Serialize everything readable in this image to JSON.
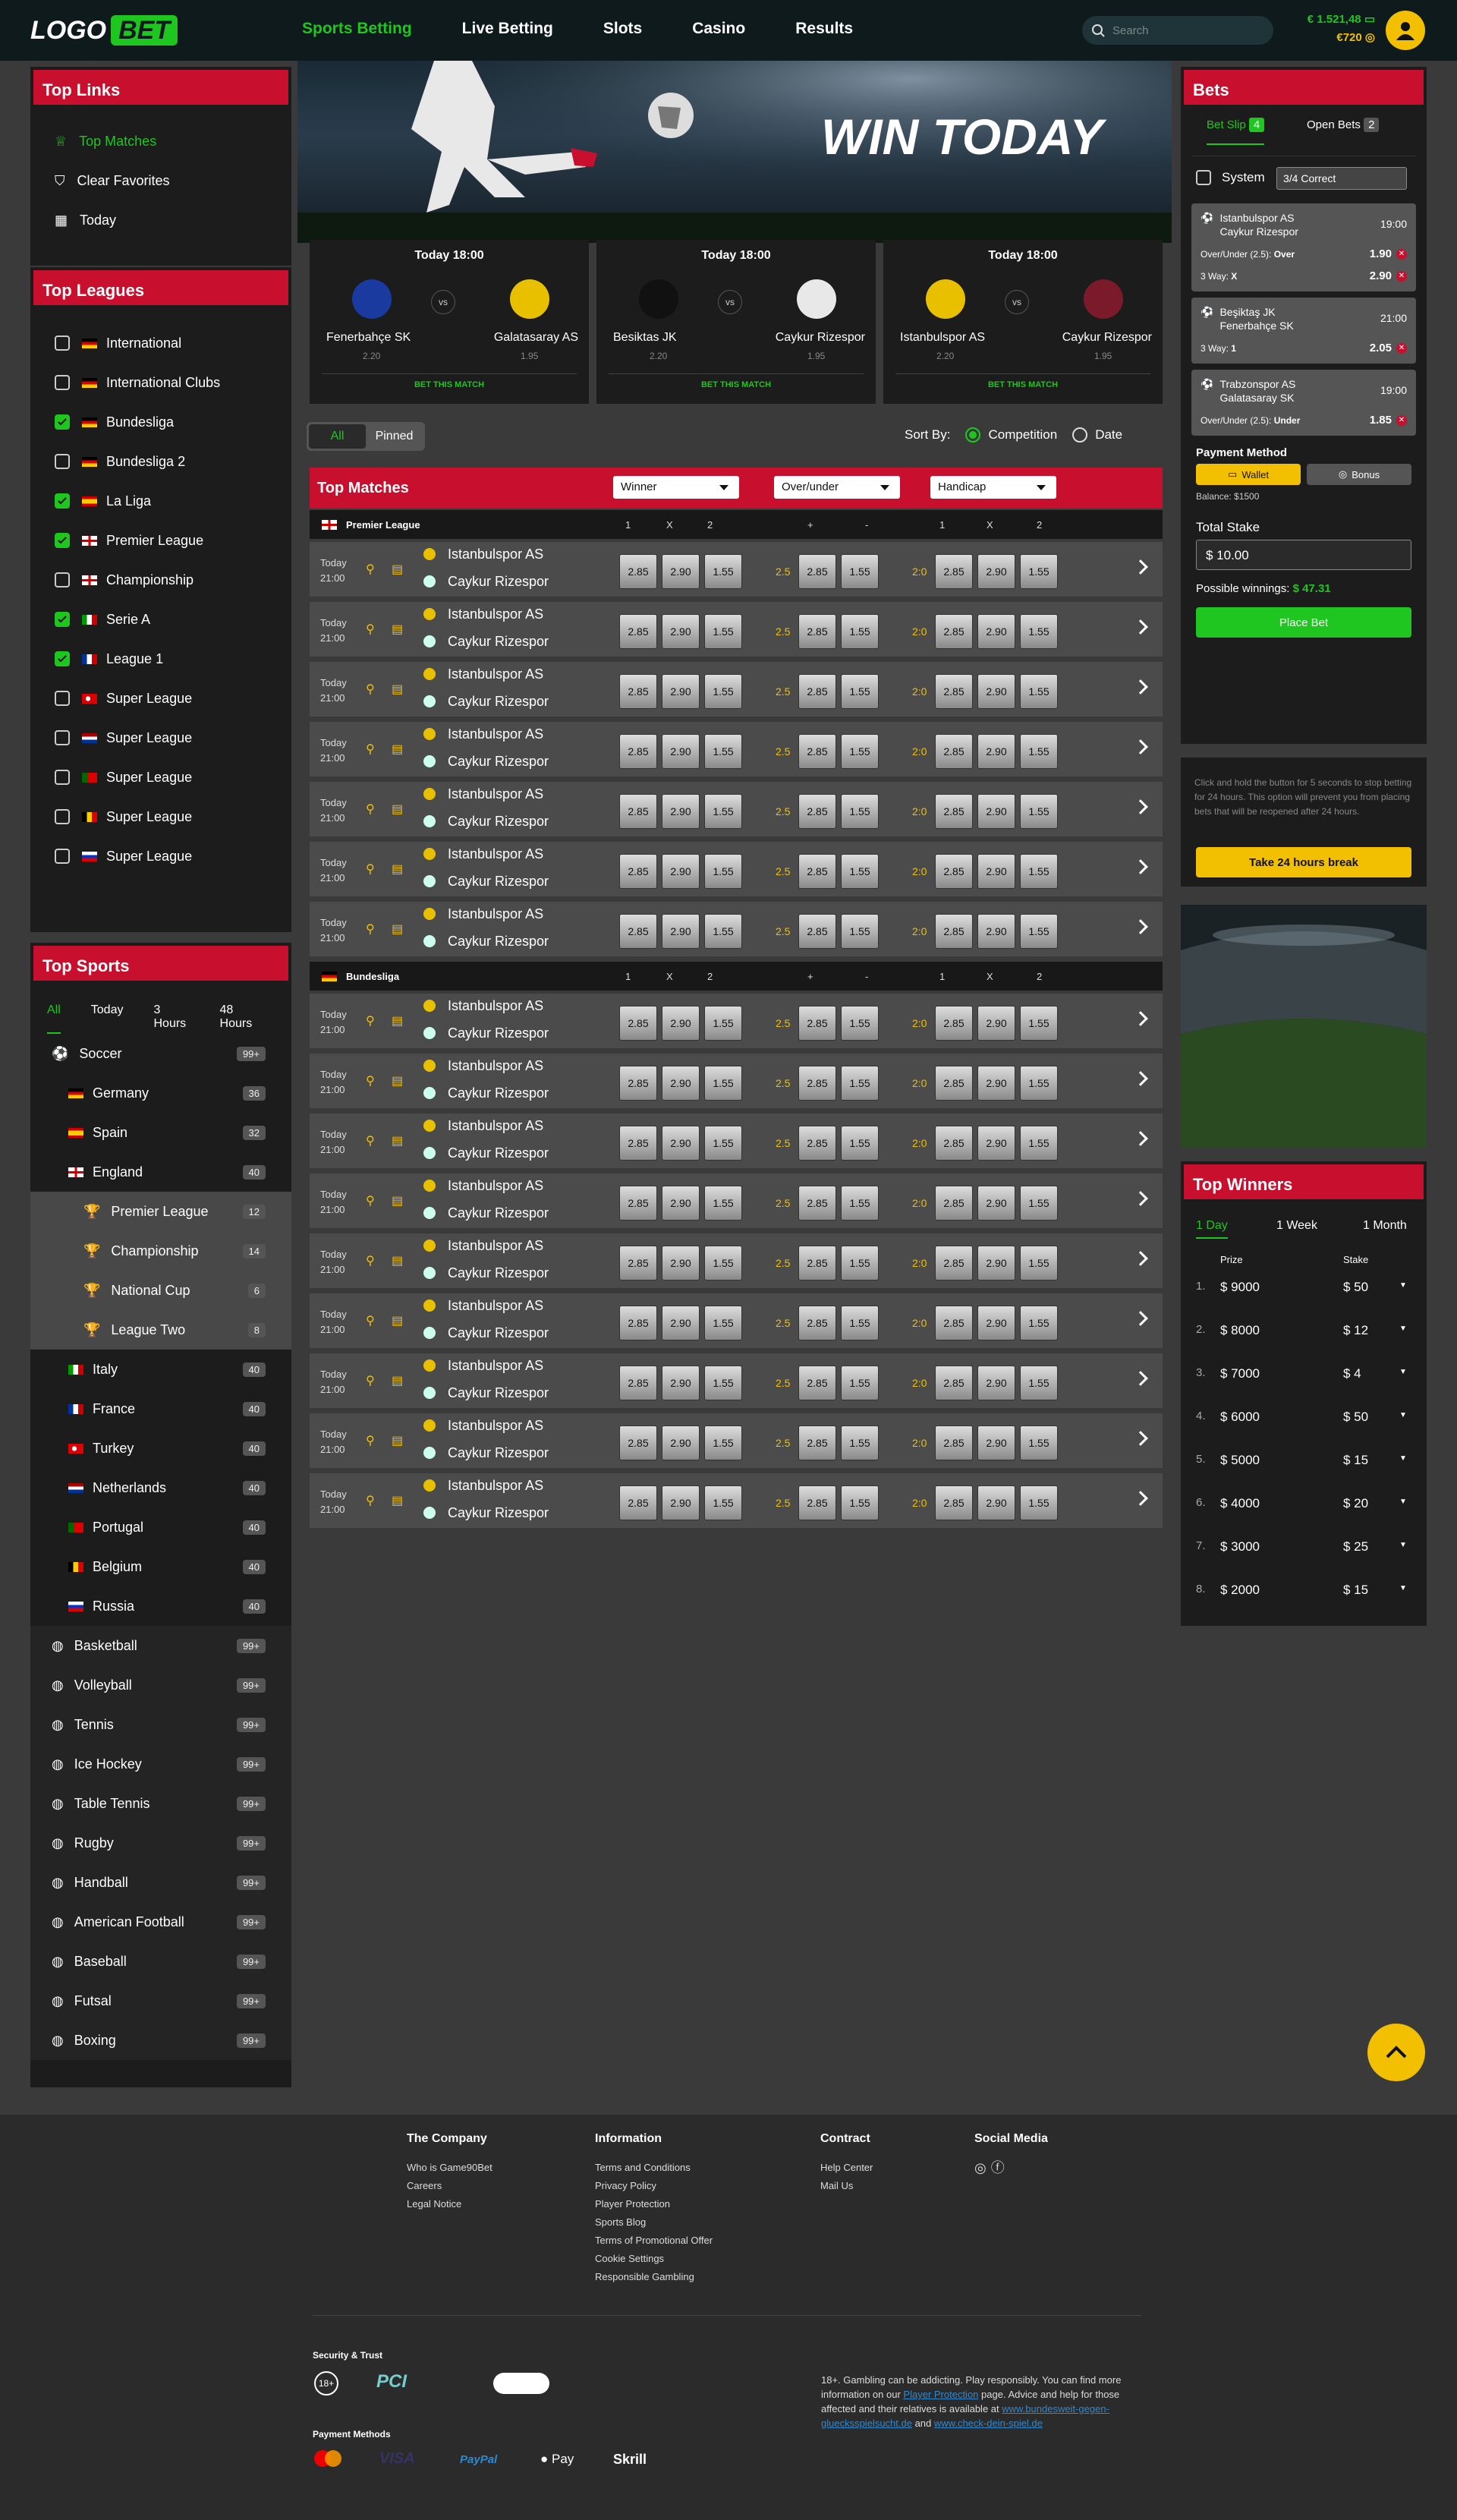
{
  "header": {
    "logo_a": "LOGO",
    "logo_b": "BET",
    "nav": [
      "Sports Betting",
      "Live Betting",
      "Slots",
      "Casino",
      "Results"
    ],
    "search_placeholder": "Search",
    "balance_main": "€ 1.521,48",
    "balance_bonus": "€720"
  },
  "top_links": {
    "title": "Top Links",
    "items": [
      "Top Matches",
      "Clear Favorites",
      "Today"
    ]
  },
  "top_leagues": {
    "title": "Top Leagues",
    "items": [
      {
        "name": "International",
        "checked": false,
        "flag": "de"
      },
      {
        "name": "International Clubs",
        "checked": false,
        "flag": "de"
      },
      {
        "name": "Bundesliga",
        "checked": true,
        "flag": "de"
      },
      {
        "name": "Bundesliga 2",
        "checked": false,
        "flag": "de"
      },
      {
        "name": "La Liga",
        "checked": true,
        "flag": "es"
      },
      {
        "name": "Premier League",
        "checked": true,
        "flag": "en"
      },
      {
        "name": "Championship",
        "checked": false,
        "flag": "en"
      },
      {
        "name": "Serie A",
        "checked": true,
        "flag": "it"
      },
      {
        "name": "League 1",
        "checked": true,
        "flag": "fr"
      },
      {
        "name": "Super League",
        "checked": false,
        "flag": "tr"
      },
      {
        "name": "Super League",
        "checked": false,
        "flag": "nl"
      },
      {
        "name": "Super League",
        "checked": false,
        "flag": "pt"
      },
      {
        "name": "Super League",
        "checked": false,
        "flag": "be"
      },
      {
        "name": "Super League",
        "checked": false,
        "flag": "ru"
      }
    ]
  },
  "top_sports": {
    "title": "Top Sports",
    "tabs": [
      "All",
      "Today",
      "3 Hours",
      "48 Hours"
    ],
    "soccer": {
      "name": "Soccer",
      "count": "99+"
    },
    "countries1": [
      {
        "name": "Germany",
        "count": "36",
        "flag": "de"
      },
      {
        "name": "Spain",
        "count": "32",
        "flag": "es"
      },
      {
        "name": "England",
        "count": "40",
        "flag": "en"
      }
    ],
    "leagues": [
      {
        "name": "Premier League",
        "count": "12"
      },
      {
        "name": "Championship",
        "count": "14"
      },
      {
        "name": "National Cup",
        "count": "6"
      },
      {
        "name": "League Two",
        "count": "8"
      }
    ],
    "countries2": [
      {
        "name": "Italy",
        "count": "40",
        "flag": "it"
      },
      {
        "name": "France",
        "count": "40",
        "flag": "fr"
      },
      {
        "name": "Turkey",
        "count": "40",
        "flag": "tr"
      },
      {
        "name": "Netherlands",
        "count": "40",
        "flag": "nl"
      },
      {
        "name": "Portugal",
        "count": "40",
        "flag": "pt"
      },
      {
        "name": "Belgium",
        "count": "40",
        "flag": "be"
      },
      {
        "name": "Russia",
        "count": "40",
        "flag": "ru"
      }
    ],
    "sports": [
      {
        "name": "Basketball",
        "count": "99+"
      },
      {
        "name": "Volleyball",
        "count": "99+"
      },
      {
        "name": "Tennis",
        "count": "99+"
      },
      {
        "name": "Ice Hockey",
        "count": "99+"
      },
      {
        "name": "Table Tennis",
        "count": "99+"
      },
      {
        "name": "Rugby",
        "count": "99+"
      },
      {
        "name": "Handball",
        "count": "99+"
      },
      {
        "name": "American Football",
        "count": "99+"
      },
      {
        "name": "Baseball",
        "count": "99+"
      },
      {
        "name": "Futsal",
        "count": "99+"
      },
      {
        "name": "Boxing",
        "count": "99+"
      }
    ]
  },
  "hero": {
    "text": "WIN TODAY"
  },
  "featured": [
    {
      "time": "Today 18:00",
      "home": "Fenerbahçe SK",
      "away": "Galatasaray AS",
      "odd_home": "2.20",
      "odd_away": "1.95",
      "cta": "BET THIS MATCH"
    },
    {
      "time": "Today 18:00",
      "home": "Besiktas JK",
      "away": "Caykur Rizespor",
      "odd_home": "2.20",
      "odd_away": "1.95",
      "cta": "BET THIS MATCH"
    },
    {
      "time": "Today 18:00",
      "home": "Istanbulspor AS",
      "away": "Caykur Rizespor",
      "odd_home": "2.20",
      "odd_away": "1.95",
      "cta": "BET THIS MATCH"
    }
  ],
  "filter": {
    "all": "All",
    "pinned": "Pinned",
    "sort_by": "Sort By:",
    "competition": "Competition",
    "date": "Date"
  },
  "top_matches": {
    "title": "Top Matches",
    "dd1": "Winner",
    "dd2": "Over/under",
    "dd3": "Handicap",
    "col_labels": [
      "1",
      "X",
      "2",
      "+",
      "-",
      "1",
      "X",
      "2"
    ],
    "leagues": [
      {
        "name": "Premier League",
        "flag": "en",
        "rows": 7
      },
      {
        "name": "Bundesliga",
        "flag": "de",
        "rows": 9
      }
    ],
    "row": {
      "day": "Today",
      "time": "21:00",
      "home": "Istanbulspor AS",
      "away": "Caykur Rizespor",
      "o1": "2.85",
      "o2": "2.90",
      "o3": "1.55",
      "ou": "2.5",
      "ou1": "2.85",
      "ou2": "1.55",
      "hc": "2:0",
      "h1": "2.85",
      "h2": "2.90",
      "h3": "1.55"
    }
  },
  "bets": {
    "title": "Bets",
    "bet_slip": "Bet Slip",
    "bet_slip_count": "4",
    "open_bets": "Open Bets",
    "open_bets_count": "2",
    "system": "System",
    "system_value": "3/4 Correct",
    "slips": [
      {
        "teams1": "Istanbulspor AS",
        "teams2": "Caykur Rizespor",
        "time": "19:00",
        "lines": [
          {
            "label": "Over/Under (2.5): ",
            "bold": "Over",
            "odd": "1.90"
          },
          {
            "label": "3 Way: ",
            "bold": "X",
            "odd": "2.90"
          }
        ]
      },
      {
        "teams1": "Beşiktaş JK",
        "teams2": "Fenerbahçe SK",
        "time": "21:00",
        "lines": [
          {
            "label": "3 Way: ",
            "bold": "1",
            "odd": "2.05"
          }
        ]
      },
      {
        "teams1": "Trabzonspor AS",
        "teams2": "Galatasaray SK",
        "time": "19:00",
        "lines": [
          {
            "label": "Over/Under (2.5): ",
            "bold": "Under",
            "odd": "1.85"
          }
        ]
      }
    ],
    "payment_method": "Payment Method",
    "wallet": "Wallet",
    "bonus": "Bonus",
    "balance": "Balance: $1500",
    "total_stake": "Total Stake",
    "stake_value": "$ 10.00",
    "possible_winnings": "Possible winnings:",
    "winnings_value": "$ 47.31",
    "place_bet": "Place Bet"
  },
  "break": {
    "text": "Click and hold the button for 5 seconds to stop betting for 24 hours. This option will prevent you from placing bets that will be reopened after 24 hours.",
    "button": "Take 24 hours break"
  },
  "top_winners": {
    "title": "Top Winners",
    "tabs": [
      "1 Day",
      "1 Week",
      "1 Month"
    ],
    "prize": "Prize",
    "stake": "Stake",
    "rows": [
      {
        "n": "1.",
        "prize": "$ 9000",
        "stake": "$ 50"
      },
      {
        "n": "2.",
        "prize": "$ 8000",
        "stake": "$ 12"
      },
      {
        "n": "3.",
        "prize": "$ 7000",
        "stake": "$ 4"
      },
      {
        "n": "4.",
        "prize": "$ 6000",
        "stake": "$ 50"
      },
      {
        "n": "5.",
        "prize": "$ 5000",
        "stake": "$ 15"
      },
      {
        "n": "6.",
        "prize": "$ 4000",
        "stake": "$ 20"
      },
      {
        "n": "7.",
        "prize": "$ 3000",
        "stake": "$ 25"
      },
      {
        "n": "8.",
        "prize": "$ 2000",
        "stake": "$ 15"
      }
    ]
  },
  "footer": {
    "company": {
      "title": "The Company",
      "links": [
        "Who is Game90Bet",
        "Careers",
        "Legal Notice"
      ]
    },
    "information": {
      "title": "Information",
      "links": [
        "Terms and Conditions",
        "Privacy Policy",
        "Player Protection",
        "Sports Blog",
        "Terms of Promotional Offer",
        "Cookie Settings",
        "Responsible Gambling"
      ]
    },
    "contract": {
      "title": "Contract",
      "links": [
        "Help Center",
        "Mail Us"
      ]
    },
    "social": {
      "title": "Social Media"
    },
    "security": "Security & Trust",
    "age": "18+",
    "pci": "PCI",
    "payment": "Payment Methods",
    "payments": [
      "VISA",
      "PayPal",
      "Pay",
      "Skrill"
    ],
    "disclaimer_a": "18+. Gambling can be addicting. Play responsibly. You can find more information on our ",
    "disclaimer_link": "Player Protection",
    "disclaimer_b": " page. Advice and help for those affected and their relatives is available at ",
    "link1": "www.bundesweit-gegen-gluecksspielsucht.de",
    "and": " and ",
    "link2": "www.check-dein-spiel.de"
  }
}
